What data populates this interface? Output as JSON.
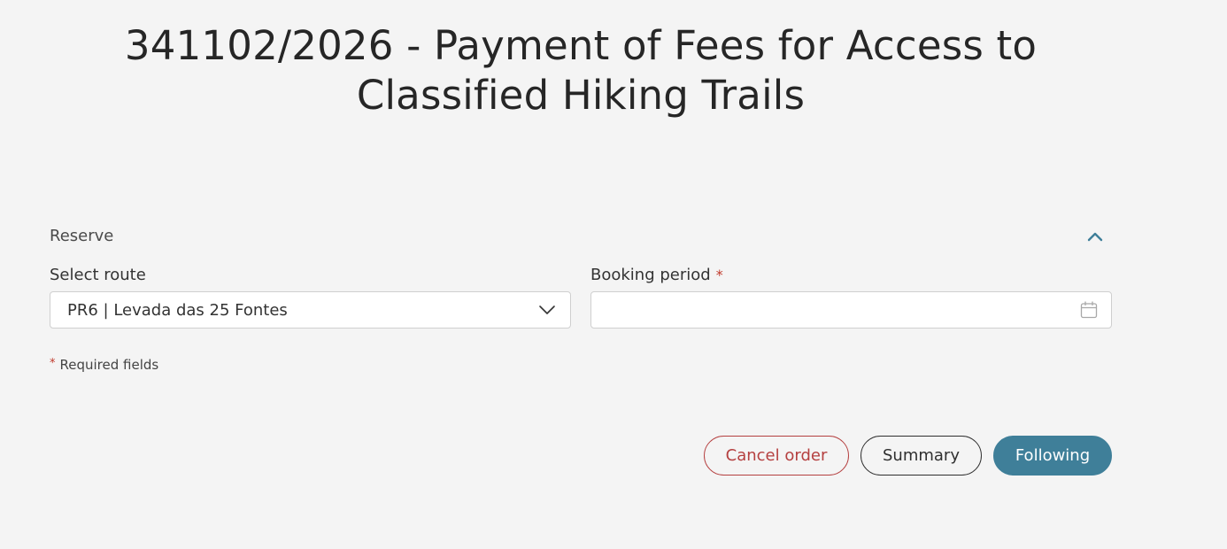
{
  "page": {
    "title": "341102/2026 - Payment of Fees for Access to Classified Hiking Trails"
  },
  "section": {
    "title": "Reserve",
    "toggle_icon": "chevron-up-icon"
  },
  "fields": {
    "route": {
      "label": "Select route",
      "value": "PR6 | Levada das 25 Fontes",
      "icon": "chevron-down-icon"
    },
    "booking_period": {
      "label": "Booking period",
      "required_marker": "*",
      "value": "",
      "icon": "calendar-icon"
    }
  },
  "required_note": {
    "marker": "*",
    "text": "Required fields"
  },
  "buttons": {
    "cancel": "Cancel order",
    "summary": "Summary",
    "next": "Following"
  },
  "colors": {
    "background": "#f4f4f4",
    "primary": "#3f7f99",
    "danger": "#b54040",
    "required": "#c0392b"
  }
}
